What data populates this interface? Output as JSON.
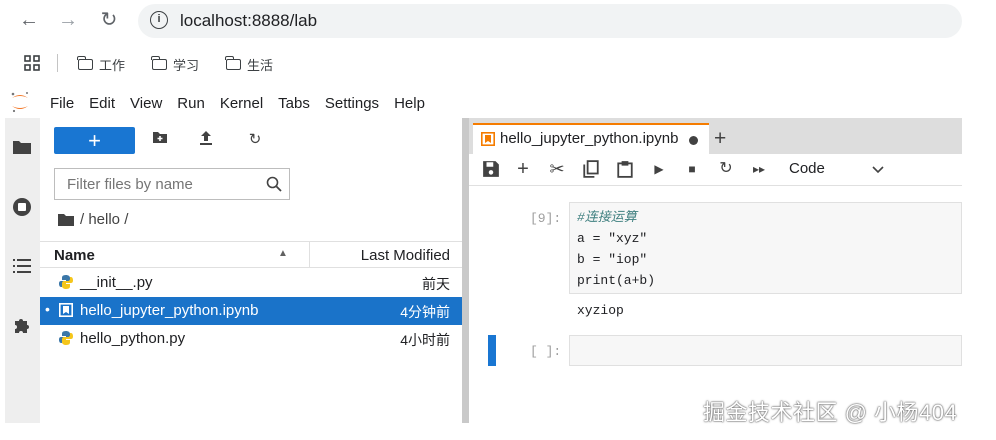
{
  "browser": {
    "url": "localhost:8888/lab",
    "bookmarks": [
      "工作",
      "学习",
      "生活"
    ]
  },
  "menu": [
    "File",
    "Edit",
    "View",
    "Run",
    "Kernel",
    "Tabs",
    "Settings",
    "Help"
  ],
  "filebrowser": {
    "new_label": "+",
    "filter_placeholder": "Filter files by name",
    "breadcrumb": "/ hello /",
    "col_name": "Name",
    "col_modified": "Last Modified",
    "files": [
      {
        "name": "__init__.py",
        "modified": "前天",
        "icon": "python-icon"
      },
      {
        "name": "hello_jupyter_python.ipynb",
        "modified": "4分钟前",
        "icon": "notebook-icon",
        "selected": true
      },
      {
        "name": "hello_python.py",
        "modified": "4小时前",
        "icon": "python-icon"
      }
    ]
  },
  "notebook": {
    "tab_title": "hello_jupyter_python.ipynb",
    "cell_type": "Code",
    "cells": [
      {
        "prompt": "[9]:",
        "code": [
          "#连接运算",
          "a = \"xyz\"",
          "b = \"iop\"",
          "print(a+b)"
        ],
        "output": "xyziop"
      },
      {
        "prompt": "[ ]:"
      }
    ]
  },
  "watermark": "掘金技术社区 @ 小杨404",
  "colors": {
    "accent": "#1976d2",
    "tab_top": "#f57c00"
  }
}
